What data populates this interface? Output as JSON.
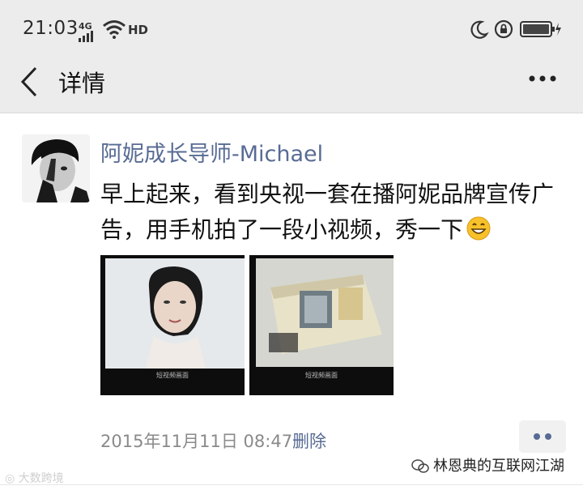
{
  "status_bar": {
    "time": "21:03",
    "network": "4G",
    "hd": "HD",
    "icons": [
      "signal-icon",
      "wifi-icon",
      "moon-icon",
      "rotation-lock-icon",
      "battery-icon"
    ]
  },
  "nav": {
    "title": "详情",
    "icons": [
      "back-chevron-icon",
      "more-dots-icon"
    ]
  },
  "post": {
    "author": "阿妮成长导师-Michael",
    "text": "早上起来，看到央视一套在播阿妮品牌宣传广告，用手机拍了一段小视频，秀一下",
    "emoji": "grinning-face-emoji",
    "images": [
      {
        "caption": "短视频画面",
        "subject": "woman portrait on TV screen"
      },
      {
        "caption": "短视频画面",
        "subject": "product box on TV screen"
      }
    ],
    "timestamp": "2015年11月11日 08:47",
    "delete_label": "删除"
  },
  "watermarks": {
    "right": "林恩典的互联网江湖",
    "left": "大数跨境"
  },
  "colors": {
    "link": "#586b94",
    "bar_bg": "#ececec",
    "meta_gray": "#8a8a8a"
  }
}
